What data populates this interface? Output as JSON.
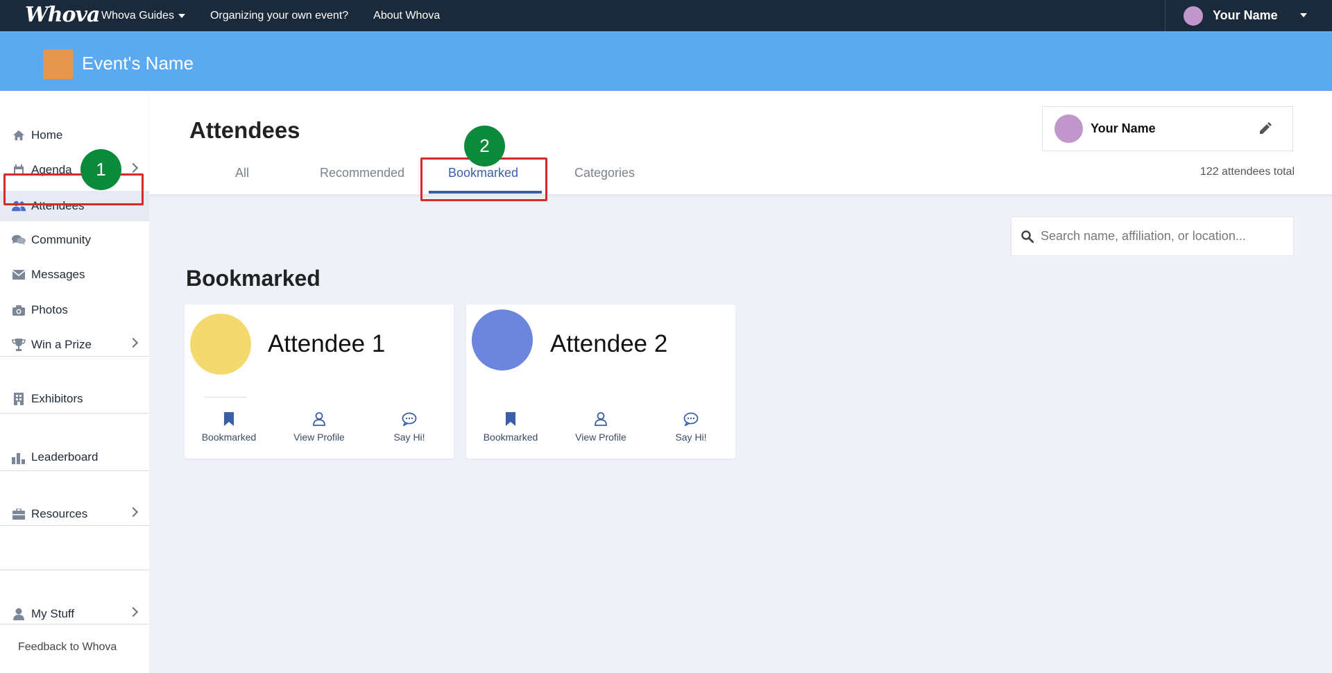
{
  "topbar": {
    "logo": "Whova",
    "nav": [
      {
        "label": "Whova Guides",
        "has_caret": true
      },
      {
        "label": "Organizing your own event?"
      },
      {
        "label": "About Whova"
      }
    ],
    "user_name": "Your Name"
  },
  "event": {
    "name": "Event's Name",
    "logo_color": "#e5954e",
    "banner_color": "#5ba9ef"
  },
  "sidebar": {
    "items": [
      {
        "label": "Home",
        "icon": "home-icon"
      },
      {
        "label": "Agenda",
        "icon": "calendar-icon"
      },
      {
        "label": "Attendees",
        "icon": "users-icon"
      },
      {
        "label": "Community",
        "icon": "chat-bubbles-icon"
      },
      {
        "label": "Messages",
        "icon": "envelope-icon"
      },
      {
        "label": "Photos",
        "icon": "camera-icon"
      },
      {
        "label": "Win a Prize",
        "icon": "trophy-icon"
      },
      {
        "label": "Exhibitors",
        "icon": "building-icon"
      },
      {
        "label": "Leaderboard",
        "icon": "bar-chart-icon"
      },
      {
        "label": "Resources",
        "icon": "briefcase-icon"
      },
      {
        "label": "My Stuff",
        "icon": "person-icon"
      }
    ],
    "feedback": "Feedback to Whova"
  },
  "annotations": {
    "step1": "1",
    "step2": "2"
  },
  "header": {
    "title": "Attendees",
    "tabs": [
      "All",
      "Recommended",
      "Bookmarked",
      "Categories"
    ],
    "active_tab": "Bookmarked",
    "profile_name": "Your Name",
    "attendee_count": "122 attendees total"
  },
  "search": {
    "placeholder": "Search name, affiliation, or location..."
  },
  "section_title": "Bookmarked",
  "cards": [
    {
      "name": "Attendee 1",
      "avatar_color": "#f4da6e"
    },
    {
      "name": "Attendee 2",
      "avatar_color": "#6b86dc"
    }
  ],
  "card_actions": {
    "bookmarked": "Bookmarked",
    "view_profile": "View Profile",
    "say_hi": "Say Hi!"
  },
  "colors": {
    "topbar": "#1b2a3a",
    "accent": "#3b5ea9",
    "annotation_green": "#0c8a3c",
    "annotation_red": "#d62a2a"
  }
}
